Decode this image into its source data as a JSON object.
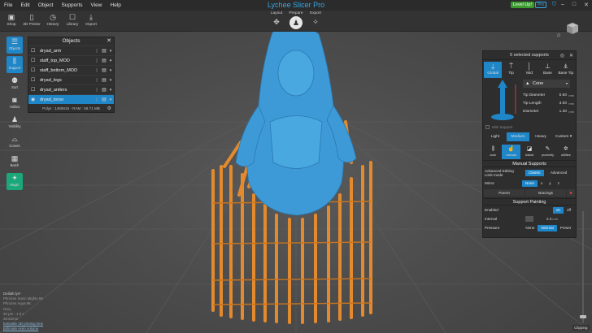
{
  "app": {
    "title": "Lychee Slicer Pro",
    "level_up": "Level Up!",
    "pro": "Pro"
  },
  "menu": [
    "File",
    "Edit",
    "Object",
    "Supports",
    "View",
    "Help"
  ],
  "toolbar": [
    {
      "icon": "shop-icon",
      "label": "Shop"
    },
    {
      "icon": "printer-icon",
      "label": "3D Printer"
    },
    {
      "icon": "history-icon",
      "label": "History"
    },
    {
      "icon": "library-icon",
      "label": "Library"
    },
    {
      "icon": "import-icon",
      "label": "Import"
    }
  ],
  "modes": {
    "layout": "Layout",
    "prepare": "Prepare",
    "export": "Export",
    "active": "Prepare"
  },
  "left_tools": [
    {
      "icon": "objects-icon",
      "label": "Objects",
      "active": true
    },
    {
      "icon": "support-icon",
      "label": "Support",
      "active": true
    },
    {
      "icon": "sort-icon",
      "label": "Sort"
    },
    {
      "icon": "hollow-icon",
      "label": "Hollow"
    },
    {
      "icon": "visibility-icon",
      "label": "Visibility"
    },
    {
      "icon": "covers-icon",
      "label": "Covers"
    },
    {
      "icon": "batch-icon",
      "label": "Batch"
    },
    {
      "icon": "magic-icon",
      "label": "Magic"
    }
  ],
  "objects_panel": {
    "title": "Objects",
    "items": [
      {
        "name": "dryad_arm",
        "selected": false
      },
      {
        "name": "staff_top_MOD",
        "selected": false
      },
      {
        "name": "staff_bottom_MOD",
        "selected": false
      },
      {
        "name": "dryad_legs",
        "selected": false
      },
      {
        "name": "dryad_antlers",
        "selected": false
      },
      {
        "name": "dryad_torso",
        "selected": true
      }
    ],
    "footer": "Polys : 1465916 - RAM : 58.71 MB"
  },
  "supports_panel": {
    "header": "0 selected supports",
    "tip_types": [
      {
        "label": "Global",
        "active": true
      },
      {
        "label": "Tip"
      },
      {
        "label": "Mid"
      },
      {
        "label": "Base"
      },
      {
        "label": "Base Tip"
      }
    ],
    "shape": "Cone",
    "params": [
      {
        "label": "Tip Diameter",
        "value": "0.60",
        "unit": "mm"
      },
      {
        "label": "Tip Length",
        "value": "3.00",
        "unit": "mm"
      },
      {
        "label": "Diameter",
        "value": "1.30",
        "unit": "mm"
      }
    ],
    "mini_support": "Mini Support",
    "density": [
      {
        "label": "Light"
      },
      {
        "label": "Medium",
        "active": true
      },
      {
        "label": "Heavy"
      },
      {
        "label": "Custom ▾"
      }
    ],
    "modes": [
      {
        "label": "auto"
      },
      {
        "label": "manual",
        "active": true
      },
      {
        "label": "island"
      },
      {
        "label": "proximity"
      },
      {
        "label": "utilities"
      }
    ],
    "manual_title": "Manual Supports",
    "advanced_label": "Advanced Editing\nLimit mode",
    "classic": "Classic",
    "advanced": "Advanced",
    "mirror_label": "Mirror",
    "mirror_none": "None",
    "mirror_axes": [
      "x",
      "y",
      "z"
    ],
    "parent": "Parent",
    "bracings": "Bracings",
    "painting_title": "Support Painting",
    "enabled_label": "Enabled",
    "on": "on",
    "off": "off",
    "interval_label": "Interval",
    "interval_value": "2.4",
    "interval_unit": "mm",
    "pressure_label": "Pressure",
    "pressure": [
      "None",
      "Internal",
      "Preset"
    ],
    "pressure_active": "Internal"
  },
  "info": {
    "file": "Delilah.lys*",
    "lines": [
      "Phrozen Sonic Mighty 8K",
      "Phrozen Aqua 8K",
      "Grey",
      "30 µm - 1.9 s",
      "28.52mm"
    ],
    "link1": "Estimate 3D printing time",
    "link2": "Estimate resin volume"
  },
  "clipping": "Clipping",
  "colors": {
    "accent": "#1f86c8",
    "model": "#3e9ad6",
    "supports": "#e38a2e",
    "magic": "#1aa87a"
  }
}
